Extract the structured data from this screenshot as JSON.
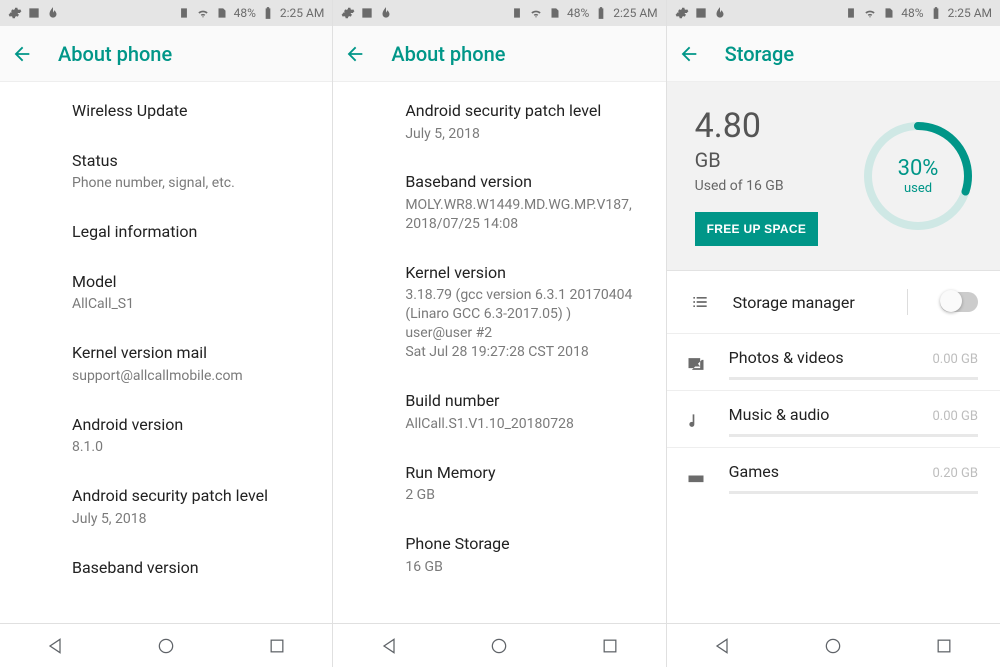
{
  "status_bar": {
    "battery_pct": "48%",
    "time": "2:25 AM"
  },
  "panels": [
    {
      "title": "About phone",
      "items": [
        {
          "title": "Wireless Update",
          "sub": ""
        },
        {
          "title": "Status",
          "sub": "Phone number, signal, etc."
        },
        {
          "title": "Legal information",
          "sub": ""
        },
        {
          "title": "Model",
          "sub": "AllCall_S1"
        },
        {
          "title": "Kernel version mail",
          "sub": "support@allcallmobile.com"
        },
        {
          "title": "Android version",
          "sub": "8.1.0"
        },
        {
          "title": "Android security patch level",
          "sub": "July 5, 2018"
        },
        {
          "title": "Baseband version",
          "sub": ""
        }
      ]
    },
    {
      "title": "About phone",
      "items": [
        {
          "title": "Android security patch level",
          "sub": "July 5, 2018"
        },
        {
          "title": "Baseband version",
          "sub": "MOLY.WR8.W1449.MD.WG.MP.V187, 2018/07/25 14:08"
        },
        {
          "title": "Kernel version",
          "sub": "3.18.79 (gcc version 6.3.1 20170404 (Linaro GCC 6.3-2017.05) )\nuser@user #2\nSat Jul 28 19:27:28 CST 2018"
        },
        {
          "title": "Build number",
          "sub": "AllCall.S1.V1.10_20180728"
        },
        {
          "title": "Run Memory",
          "sub": "2 GB"
        },
        {
          "title": "Phone Storage",
          "sub": "16 GB"
        }
      ]
    },
    {
      "title": "Storage",
      "storage": {
        "used_num": "4.80",
        "used_unit": "GB",
        "used_of": "Used of 16 GB",
        "free_btn": "FREE UP SPACE",
        "pct": "30%",
        "pct_caption": "used",
        "pct_value": 30
      },
      "storage_rows": [
        {
          "icon": "list",
          "title": "Storage manager",
          "kind": "toggle"
        },
        {
          "icon": "photos",
          "title": "Photos & videos",
          "value": "0.00 GB"
        },
        {
          "icon": "music",
          "title": "Music & audio",
          "value": "0.00 GB"
        },
        {
          "icon": "games",
          "title": "Games",
          "value": "0.20 GB"
        }
      ]
    }
  ],
  "accent": "#009688"
}
